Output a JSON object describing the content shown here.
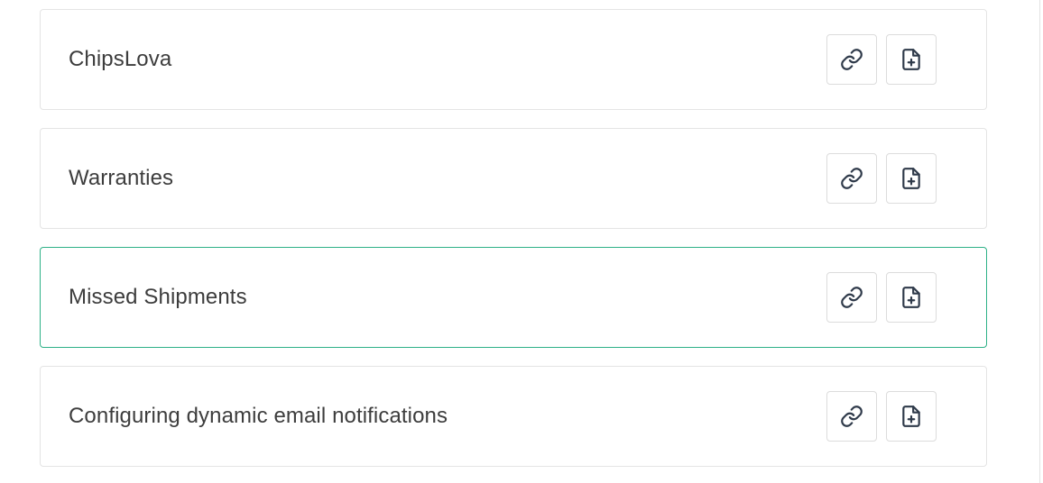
{
  "colors": {
    "selected_border": "#2eb187",
    "card_border": "#e4e4e4",
    "title_text": "#3d3d3d",
    "icon_stroke": "#2f3a4a"
  },
  "icons": {
    "link": "link-icon",
    "add_document": "file-plus-icon"
  },
  "cards": [
    {
      "title": "ChipsLova",
      "selected": false
    },
    {
      "title": "Warranties",
      "selected": false
    },
    {
      "title": "Missed Shipments",
      "selected": true
    },
    {
      "title": "Configuring dynamic email notifications",
      "selected": false
    }
  ]
}
